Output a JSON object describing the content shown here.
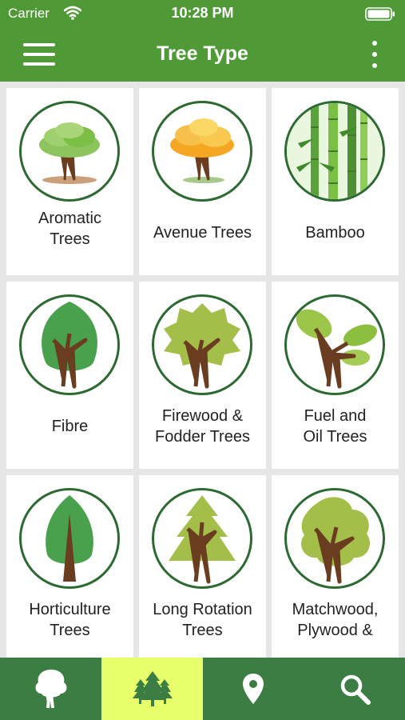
{
  "status_bar": {
    "carrier": "Carrier",
    "time": "10:28 PM",
    "wifi_icon": "wifi-icon",
    "battery_icon": "battery-icon"
  },
  "app_bar": {
    "title": "Tree Type",
    "menu_icon": "hamburger-menu-icon",
    "more_icon": "more-vertical-icon"
  },
  "tree_types": [
    {
      "label": "Aromatic\nTrees",
      "icon": "aromatic-tree-icon"
    },
    {
      "label": "Avenue Trees",
      "icon": "avenue-tree-icon"
    },
    {
      "label": "Bamboo",
      "icon": "bamboo-icon"
    },
    {
      "label": "Fibre",
      "icon": "fibre-tree-icon"
    },
    {
      "label": "Firewood &\nFodder Trees",
      "icon": "firewood-tree-icon"
    },
    {
      "label": "Fuel and\nOil Trees",
      "icon": "fuel-oil-tree-icon"
    },
    {
      "label": "Horticulture\nTrees",
      "icon": "horticulture-tree-icon"
    },
    {
      "label": "Long Rotation\nTrees",
      "icon": "long-rotation-tree-icon"
    },
    {
      "label": "Matchwood,\nPlywood &",
      "icon": "matchwood-tree-icon"
    }
  ],
  "bottom_nav": {
    "active_index": 1,
    "tabs": [
      {
        "icon": "tree-icon"
      },
      {
        "icon": "pine-trees-icon"
      },
      {
        "icon": "location-pin-icon"
      },
      {
        "icon": "search-icon"
      }
    ]
  },
  "colors": {
    "header_green": "#4f9a37",
    "nav_green": "#3c7d44",
    "nav_active": "#e6ff6a",
    "circle_border": "#2d6a32",
    "trunk_brown": "#6b3d20",
    "leaf_green": "#7cbf46",
    "leaf_yellow": "#f7b52c"
  }
}
